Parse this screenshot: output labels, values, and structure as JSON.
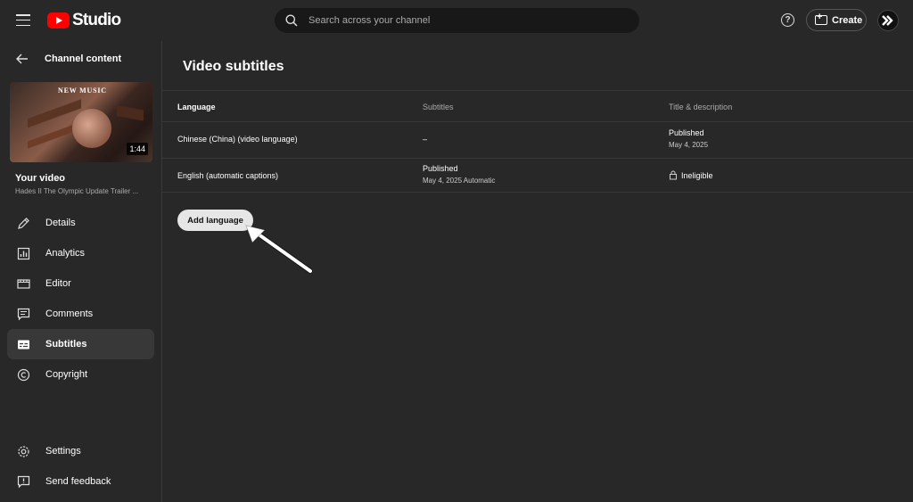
{
  "topbar": {
    "brand": "Studio",
    "search_placeholder": "Search across your channel",
    "help_glyph": "?",
    "create_label": "Create"
  },
  "sidebar": {
    "back_label": "Channel content",
    "thumbnail_tag": "New Music",
    "duration": "1:44",
    "your_video_label": "Your video",
    "video_title": "Hades II The Olympic Update Trailer ...",
    "items": [
      {
        "label": "Details",
        "icon": "pencil-icon"
      },
      {
        "label": "Analytics",
        "icon": "analytics-icon"
      },
      {
        "label": "Editor",
        "icon": "editor-icon"
      },
      {
        "label": "Comments",
        "icon": "comments-icon"
      },
      {
        "label": "Subtitles",
        "icon": "subtitles-icon",
        "active": true
      },
      {
        "label": "Copyright",
        "icon": "copyright-icon"
      }
    ],
    "bottom_items": [
      {
        "label": "Settings",
        "icon": "gear-icon"
      },
      {
        "label": "Send feedback",
        "icon": "feedback-icon"
      }
    ]
  },
  "main": {
    "title": "Video subtitles",
    "columns": [
      "Language",
      "Subtitles",
      "Title & description"
    ],
    "rows": [
      {
        "language": "Chinese (China) (video language)",
        "subtitles": "–",
        "subtitles_sub": "",
        "title_desc": "Published",
        "title_desc_sub": "May 4, 2025"
      },
      {
        "language": "English (automatic captions)",
        "subtitles": "Published",
        "subtitles_sub": "May 4, 2025 Automatic",
        "title_desc": "Ineligible",
        "title_desc_sub": ""
      }
    ],
    "add_language_label": "Add language"
  },
  "colors": {
    "brand_red": "#ff0000",
    "background": "#282828",
    "search_bg": "#181818",
    "button_light": "#e6e6e6"
  }
}
